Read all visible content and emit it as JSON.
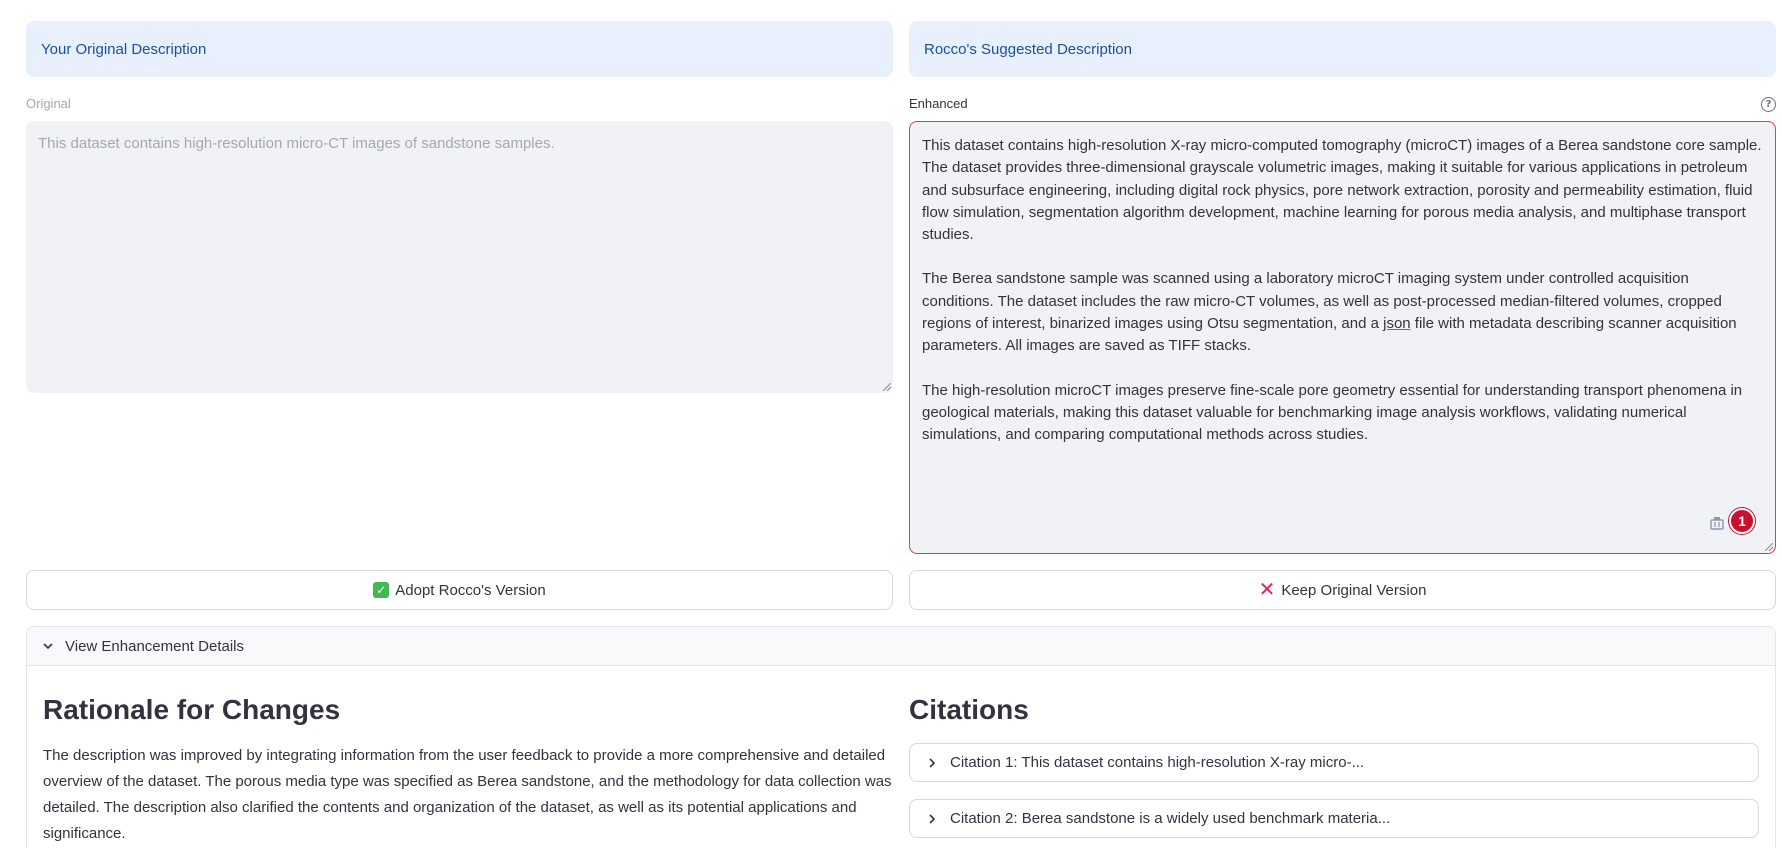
{
  "left_header": "Your Original Description",
  "right_header": "Rocco's Suggested Description",
  "original": {
    "label": "Original",
    "text": "This dataset contains high-resolution micro-CT images of sandstone samples."
  },
  "enhanced": {
    "label": "Enhanced",
    "help_icon": "?",
    "paragraphs": [
      "This dataset contains high-resolution X-ray micro-computed tomography (microCT) images of a Berea sandstone core sample. The dataset provides three-dimensional grayscale volumetric images, making it suitable for various applications in petroleum and subsurface engineering, including digital rock physics, pore network extraction, porosity and permeability estimation, fluid flow simulation, segmentation algorithm development, machine learning for porous media analysis, and multiphase transport studies.",
      "The Berea sandstone sample was scanned using a laboratory microCT imaging system under controlled acquisition conditions. The dataset includes the raw micro-CT volumes, as well as post-processed median-filtered volumes, cropped regions of interest, binarized images using Otsu segmentation, and a json file with metadata describing scanner acquisition parameters. All images are saved as TIFF stacks.",
      "The high-resolution microCT images preserve fine-scale pore geometry essential for understanding transport phenomena in geological materials, making this dataset valuable for benchmarking image analysis workflows, validating numerical simulations, and comparing computational methods across studies."
    ],
    "p2_before": "The Berea sandstone sample was scanned using a laboratory microCT imaging system under controlled acquisition conditions. The dataset includes the raw micro-CT volumes, as well as post-processed median-filtered volumes, cropped regions of interest, binarized images using Otsu segmentation, and a ",
    "p2_misspelled": "json",
    "p2_after": " file with metadata describing scanner acquisition parameters. All images are saved as TIFF stacks.",
    "error_count": "1"
  },
  "buttons": {
    "adopt": "Adopt Rocco's Version",
    "keep": "Keep Original Version"
  },
  "expander": {
    "label": "View Enhancement Details"
  },
  "rationale": {
    "title": "Rationale for Changes",
    "text": "The description was improved by integrating information from the user feedback to provide a more comprehensive and detailed overview of the dataset. The porous media type was specified as Berea sandstone, and the methodology for data collection was detailed. The description also clarified the contents and organization of the dataset, as well as its potential applications and significance."
  },
  "citations": {
    "title": "Citations",
    "items": [
      "Citation 1: This dataset contains high-resolution X-ray micro-...",
      "Citation 2: Berea sandstone is a widely used benchmark materia..."
    ]
  },
  "colors": {
    "header_bg": "#e8f0fe",
    "header_text": "#1c4f9c",
    "error_border": "#e0413d",
    "badge": "#c8102e"
  }
}
